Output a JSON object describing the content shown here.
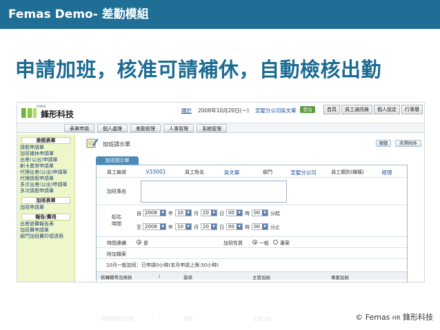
{
  "slide": {
    "banner_title": "Femas Demo- 差勤模組",
    "headline": "申請加班，核准可請補休，自動檢核出勤",
    "copyright": "© Femas",
    "copyright_hr": "HR",
    "copyright_brand": "鋒形科技"
  },
  "app": {
    "logo_small": "FEMAS",
    "logo_text": "鋒形科技",
    "top": {
      "link_about": "關於",
      "date": "2008年10月20日(一)",
      "company": "宣聖分公司",
      "user": "吳文華",
      "logout": "登出"
    },
    "top_tabs": [
      "首頁",
      "員工通訊錄",
      "個人設定",
      "行事曆"
    ],
    "menu": [
      "表單申請",
      "個人處理",
      "差勤管理",
      "人事管理",
      "系統管理"
    ],
    "sidebar": {
      "sections": [
        {
          "title": "差假表單",
          "items": [
            "請假申請單",
            "加班補休申請單",
            "出差(公出)申請單",
            "刷卡異常申請單",
            "代理出差(公出)申請單",
            "代理請假申請單",
            "多次出差(公出)申請單",
            "多次請假申請單"
          ]
        },
        {
          "title": "加班表單",
          "items": [
            "加班申請單"
          ]
        },
        {
          "title": "報告/費用",
          "items": [
            "出差旅費報告表",
            "加班費申請單",
            "部門加班費印領清冊"
          ]
        }
      ]
    },
    "main": {
      "page_title": "加班請示單",
      "btn_preview": "預覽",
      "btn_attach": "夾帶附件",
      "form_tab": "加班請示單",
      "labels": {
        "emp_no": "員工編號",
        "emp_name": "員工姓名",
        "dept": "部門",
        "emp_type": "員工類別(職稱)",
        "reason": "加班事由",
        "period_line1": "起迄",
        "period_line2": "時間",
        "from": "自",
        "to": "至",
        "year": "年",
        "month": "月",
        "day": "日",
        "hour": "時",
        "minute_start": "分起",
        "minute_end": "分止",
        "continuous": "時間連續",
        "yes": "是",
        "ot_nature": "加班性質",
        "normal": "一般",
        "project": "專案",
        "attachment": "附加檔案"
      },
      "values": {
        "emp_no": "V33001",
        "emp_name": "吳文華",
        "dept": "宣聖分公司",
        "emp_type": "經理"
      },
      "start": {
        "year": "2008",
        "month": "10",
        "day": "20",
        "hour": "00",
        "minute": "00"
      },
      "end": {
        "year": "2008",
        "month": "10",
        "day": "20",
        "hour": "00",
        "minute": "00"
      },
      "notice": "10月一般加班：已申請0小時(本月申請上限:50小時)",
      "bottom": {
        "col1": "核轉職等及條款",
        "col2": "/",
        "col3": "簽核",
        "col4": "主管加給",
        "col5": "專案加給"
      }
    }
  }
}
